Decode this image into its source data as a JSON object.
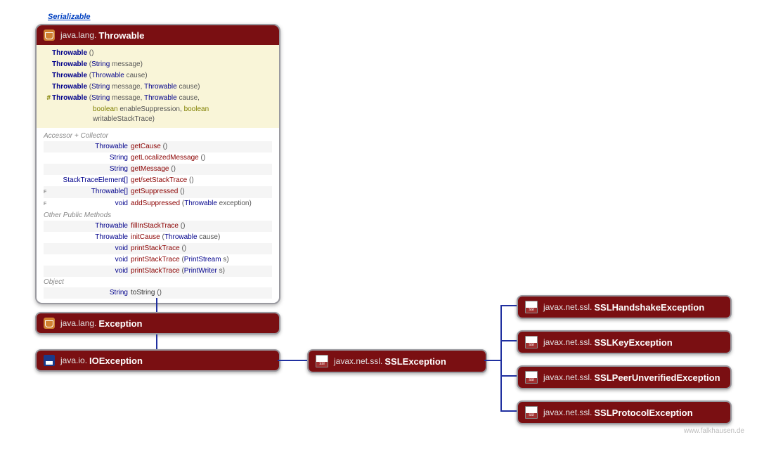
{
  "serializable": "Serializable",
  "throwable": {
    "pkg": "java.lang.",
    "name": "Throwable",
    "ctors": [
      {
        "mod": "",
        "name": "Throwable",
        "params": "()"
      },
      {
        "mod": "",
        "name": "Throwable",
        "params": "(String message)"
      },
      {
        "mod": "",
        "name": "Throwable",
        "params": "(Throwable cause)"
      },
      {
        "mod": "",
        "name": "Throwable",
        "params": "(String message, Throwable cause)"
      },
      {
        "mod": "#",
        "name": "Throwable",
        "params": "(String message, Throwable cause,",
        "cont": "boolean enableSuppression, boolean writableStackTrace)"
      }
    ],
    "sect1": "Accessor + Collector",
    "methods1": [
      {
        "rt": "Throwable",
        "name": "getCause",
        "p": "()"
      },
      {
        "rt": "String",
        "name": "getLocalizedMessage",
        "p": "()"
      },
      {
        "rt": "String",
        "name": "getMessage",
        "p": "()"
      },
      {
        "rt": "StackTraceElement[]",
        "name": "get/setStackTrace",
        "p": "()"
      },
      {
        "rt": "Throwable[]",
        "name": "getSuppressed",
        "p": "()",
        "f": "F"
      },
      {
        "rt": "void",
        "name": "addSuppressed",
        "p": "(Throwable exception)",
        "f": "F"
      }
    ],
    "sect2": "Other Public Methods",
    "methods2": [
      {
        "rt": "Throwable",
        "name": "fillInStackTrace",
        "p": "()"
      },
      {
        "rt": "Throwable",
        "name": "initCause",
        "p": "(Throwable cause)"
      },
      {
        "rt": "void",
        "name": "printStackTrace",
        "p": "()"
      },
      {
        "rt": "void",
        "name": "printStackTrace",
        "p": "(PrintStream s)"
      },
      {
        "rt": "void",
        "name": "printStackTrace",
        "p": "(PrintWriter s)"
      }
    ],
    "sect3": "Object",
    "methods3": [
      {
        "rt": "String",
        "name": "toString",
        "p": "()"
      }
    ]
  },
  "classes": {
    "exception": {
      "pkg": "java.lang.",
      "name": "Exception"
    },
    "ioexception": {
      "pkg": "java.io.",
      "name": "IOException"
    },
    "sslexception": {
      "pkg": "javax.net.ssl.",
      "name": "SSLException"
    },
    "sslhandshake": {
      "pkg": "javax.net.ssl.",
      "name": "SSLHandshakeException"
    },
    "sslkey": {
      "pkg": "javax.net.ssl.",
      "name": "SSLKeyException"
    },
    "sslpeer": {
      "pkg": "javax.net.ssl.",
      "name": "SSLPeerUnverifiedException"
    },
    "sslprotocol": {
      "pkg": "javax.net.ssl.",
      "name": "SSLProtocolException"
    }
  },
  "watermark": "www.falkhausen.de"
}
